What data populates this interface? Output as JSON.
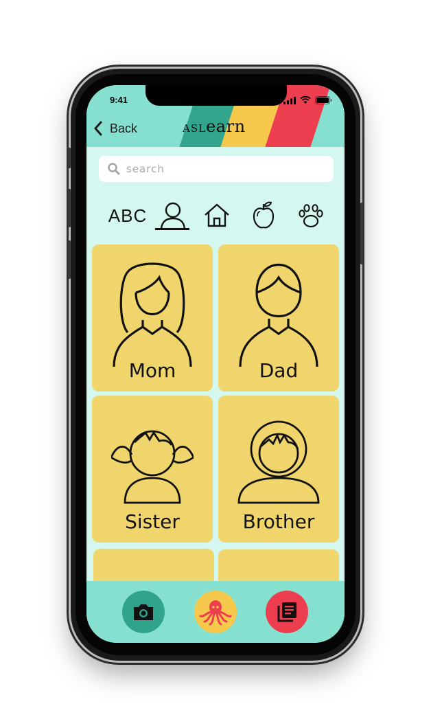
{
  "status_bar": {
    "time": "9:41"
  },
  "header": {
    "back_label": "Back",
    "title_prefix": "ASL",
    "title_suffix": "earn",
    "stripe_colors": [
      "#33a58c",
      "#f6c94d",
      "#ec3e4f"
    ]
  },
  "search": {
    "placeholder": "search"
  },
  "categories": {
    "abc_label": "ABC",
    "items": [
      "abc",
      "person-icon",
      "house-icon",
      "apple-icon",
      "paw-icon"
    ],
    "selected": "person-icon"
  },
  "cards": [
    {
      "label": "Mom",
      "icon": "mom-icon"
    },
    {
      "label": "Dad",
      "icon": "dad-icon"
    },
    {
      "label": "Sister",
      "icon": "sister-icon"
    },
    {
      "label": "Brother",
      "icon": "brother-icon"
    }
  ],
  "tabbar": {
    "items": [
      "camera-icon",
      "octopus-icon",
      "book-icon"
    ],
    "colors": [
      "#30a48a",
      "#f6c94d",
      "#ec3e4f"
    ]
  },
  "colors": {
    "background": "#d4f7f0",
    "header": "#86e0cf",
    "card": "#f0d46c"
  }
}
